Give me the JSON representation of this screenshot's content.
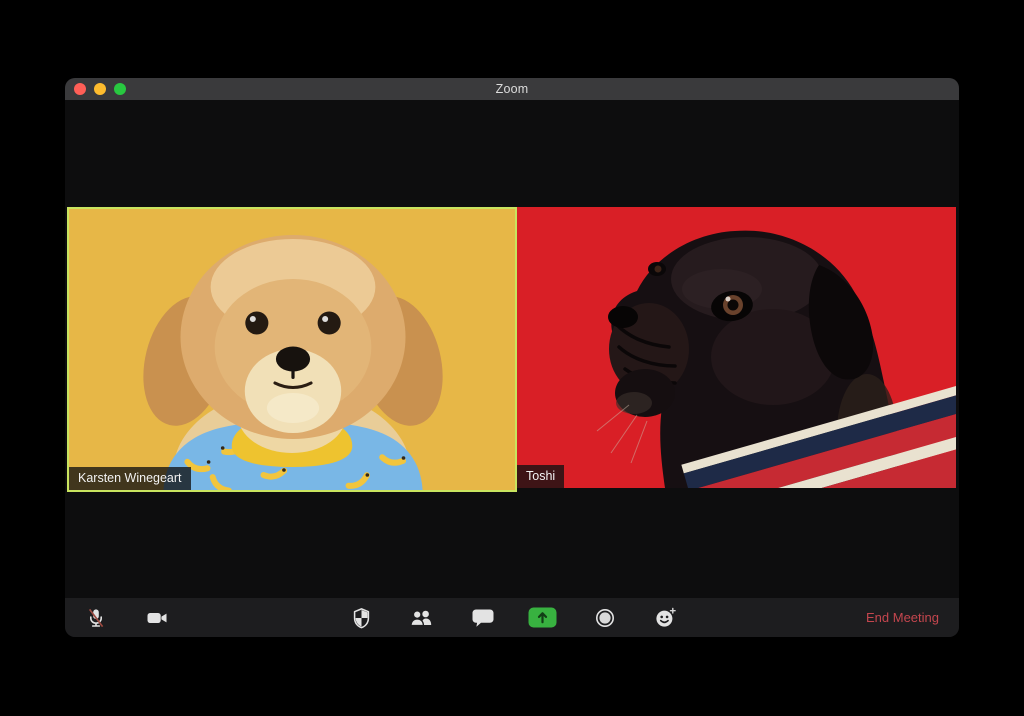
{
  "window": {
    "title": "Zoom",
    "traffic_lights": [
      {
        "name": "close",
        "color": "#ff5f57"
      },
      {
        "name": "minimize",
        "color": "#febc2e"
      },
      {
        "name": "fullscreen",
        "color": "#28c840"
      }
    ]
  },
  "participants": [
    {
      "name": "Karsten Winegeart",
      "active_speaker": true,
      "tile_background": "#e7b747"
    },
    {
      "name": "Toshi",
      "active_speaker": false,
      "tile_background": "#d91f26"
    }
  ],
  "toolbar": {
    "buttons": [
      {
        "label": "Mute",
        "icon": "microphone-muted-icon",
        "state": "muted"
      },
      {
        "label": "Video",
        "icon": "video-camera-icon",
        "state": "on"
      },
      {
        "label": "Security",
        "icon": "shield-icon"
      },
      {
        "label": "Participants",
        "icon": "participants-icon"
      },
      {
        "label": "Chat",
        "icon": "chat-bubble-icon"
      },
      {
        "label": "Share Screen",
        "icon": "share-screen-icon",
        "color": "#38b240"
      },
      {
        "label": "Record",
        "icon": "record-icon"
      },
      {
        "label": "Reactions",
        "icon": "reactions-smiley-icon"
      }
    ],
    "end_meeting_label": "End Meeting",
    "end_meeting_color": "#c4464e"
  },
  "colors": {
    "active_speaker_border": "#c9e45f",
    "titlebar": "#3a3a3c",
    "toolbar_background": "#1d1d1f",
    "stage_background": "#0d0d0e",
    "muted_slash": "#9c4a41"
  }
}
